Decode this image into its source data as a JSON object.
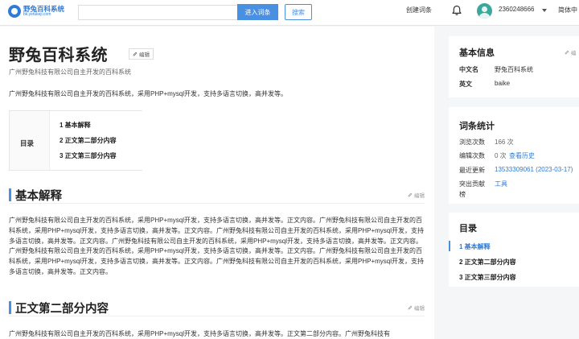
{
  "header": {
    "logo_title": "野兔百科系统",
    "logo_sub": "bk.yetukeji.com",
    "search_placeholder": "",
    "enter_button": "进入词条",
    "search_button": "搜索",
    "create_entry": "创建词条",
    "username": "2360248666",
    "language": "简体中"
  },
  "entry": {
    "title": "野兔百科系统",
    "edit_label": "编辑",
    "subtitle": "广州野兔科技有限公司自主开发的百科系统",
    "summary": "广州野兔科技有限公司自主开发的百科系统，采用PHP+mysql开发，支持多语言切换，高并发等。",
    "toc": {
      "label": "目录",
      "items": [
        "1  基本解释",
        "2  正文第二部分内容",
        "3  正文第三部分内容"
      ]
    },
    "sections": [
      {
        "title": "基本解释",
        "edit_label": "编辑",
        "text": "广州野兔科技有限公司自主开发的百科系统，采用PHP+mysql开发，支持多语言切换，高并发等。正文内容。广州野兔科技有限公司自主开发的百科系统，采用PHP+mysql开发，支持多语言切换，高并发等。正文内容。广州野兔科技有限公司自主开发的百科系统，采用PHP+mysql开发，支持多语言切换，高并发等。正文内容。广州野兔科技有限公司自主开发的百科系统，采用PHP+mysql开发，支持多语言切换，高并发等。正文内容。广州野兔科技有限公司自主开发的百科系统，采用PHP+mysql开发，支持多语言切换，高并发等。正文内容。广州野兔科技有限公司自主开发的百科系统，采用PHP+mysql开发，支持多语言切换，高并发等。正文内容。广州野兔科技有限公司自主开发的百科系统，采用PHP+mysql开发，支持多语言切换，高并发等。正文内容。"
      },
      {
        "title": "正文第二部分内容",
        "edit_label": "编辑",
        "text": "广州野兔科技有限公司自主开发的百科系统，采用PHP+mysql开发，支持多语言切换，高并发等。正文第二部分内容。广州野兔科技有"
      }
    ]
  },
  "sidebar": {
    "basic_info": {
      "title": "基本信息",
      "edit_label": "编",
      "rows": [
        {
          "key": "中文名",
          "value": "野兔百科系统"
        },
        {
          "key": "英文",
          "value": "baike"
        }
      ]
    },
    "stats": {
      "title": "词条统计",
      "views_key": "浏览次数",
      "views_value": "166 次",
      "edits_key": "编辑次数",
      "edits_value": "0 次",
      "history_link": "查看历史",
      "updated_key": "最近更新",
      "updated_value": "13533309061 (2023-03-17)",
      "contrib_key_1": "突出贡献",
      "contrib_key_2": "榜",
      "contrib_value": "工具"
    },
    "toc": {
      "title": "目录",
      "items": [
        "1  基本解释",
        "2  正文第二部分内容",
        "3  正文第三部分内容"
      ]
    }
  },
  "colors": {
    "accent": "#4a90e2",
    "link": "#2f7bd6"
  }
}
